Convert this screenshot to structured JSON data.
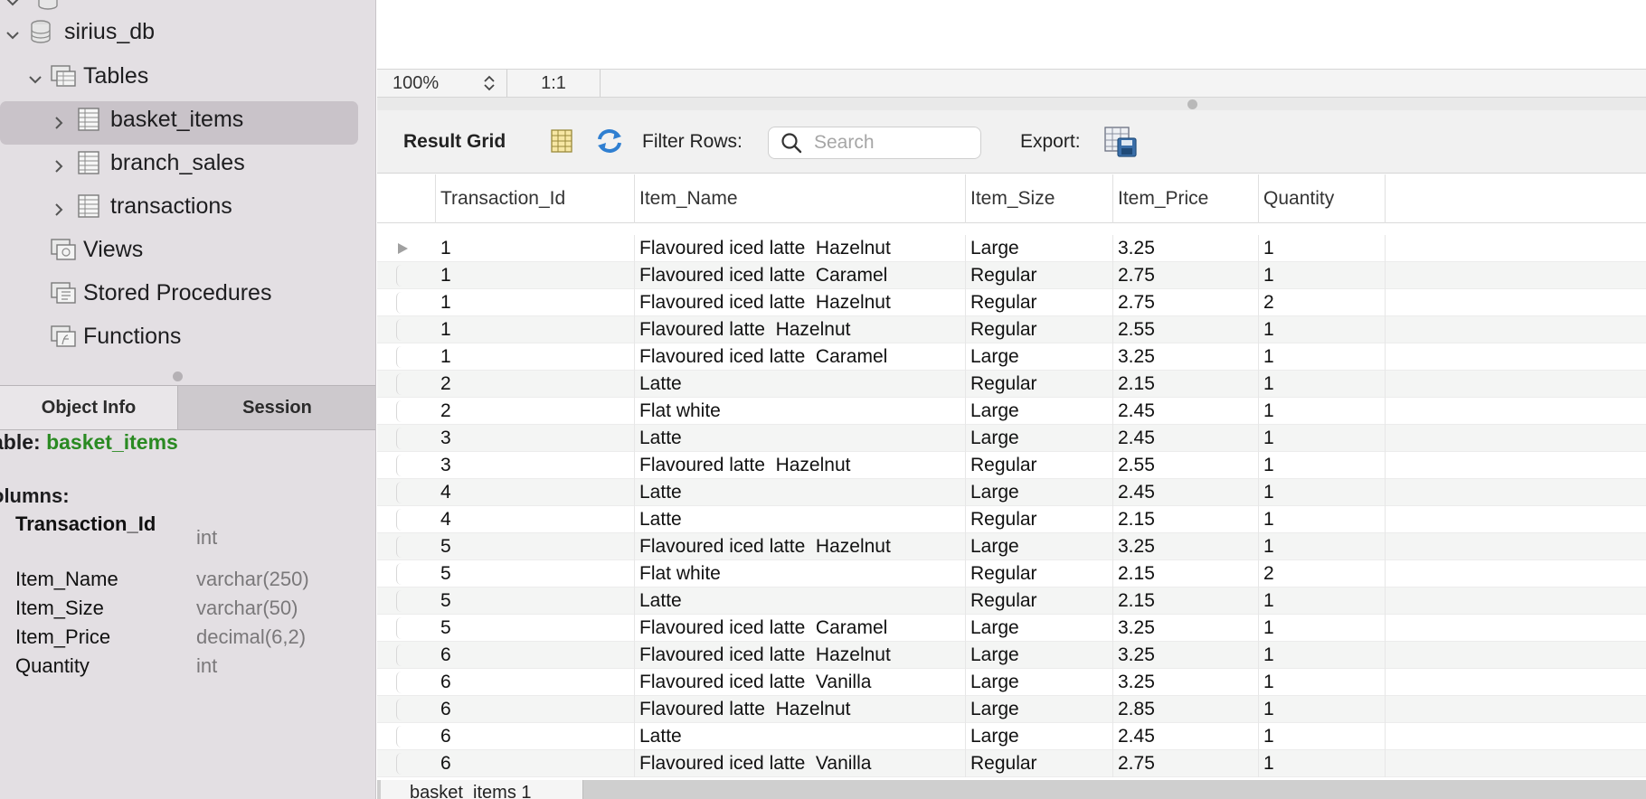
{
  "navigator": {
    "schema": "sirius_db",
    "tables_label": "Tables",
    "tables": [
      "basket_items",
      "branch_sales",
      "transactions"
    ],
    "selected_table": "basket_items",
    "views_label": "Views",
    "procedures_label": "Stored Procedures",
    "functions_label": "Functions"
  },
  "info_panel": {
    "tabs": [
      "Object Info",
      "Session"
    ],
    "active_tab": "Object Info",
    "table_prefix": "able:",
    "table_name": "basket_items",
    "columns_label": "olumns:",
    "columns": [
      {
        "name": "Transaction_Id",
        "type": "int"
      },
      {
        "name": "Item_Name",
        "type": "varchar(250)"
      },
      {
        "name": "Item_Size",
        "type": "varchar(50)"
      },
      {
        "name": "Item_Price",
        "type": "decimal(6,2)"
      },
      {
        "name": "Quantity",
        "type": "int"
      }
    ]
  },
  "editor": {
    "zoom": "100%",
    "ratio": "1:1"
  },
  "result_toolbar": {
    "title": "Result Grid",
    "filter_label": "Filter Rows:",
    "search_placeholder": "Search",
    "export_label": "Export:"
  },
  "grid": {
    "columns": [
      "Transaction_Id",
      "Item_Name",
      "Item_Size",
      "Item_Price",
      "Quantity"
    ],
    "rows": [
      [
        "1",
        "Flavoured iced latte  Hazelnut",
        "Large",
        "3.25",
        "1"
      ],
      [
        "1",
        "Flavoured iced latte  Caramel",
        "Regular",
        "2.75",
        "1"
      ],
      [
        "1",
        "Flavoured iced latte  Hazelnut",
        "Regular",
        "2.75",
        "2"
      ],
      [
        "1",
        "Flavoured latte  Hazelnut",
        "Regular",
        "2.55",
        "1"
      ],
      [
        "1",
        "Flavoured iced latte  Caramel",
        "Large",
        "3.25",
        "1"
      ],
      [
        "2",
        "Latte",
        "Regular",
        "2.15",
        "1"
      ],
      [
        "2",
        "Flat white",
        "Large",
        "2.45",
        "1"
      ],
      [
        "3",
        "Latte",
        "Large",
        "2.45",
        "1"
      ],
      [
        "3",
        "Flavoured latte  Hazelnut",
        "Regular",
        "2.55",
        "1"
      ],
      [
        "4",
        "Latte",
        "Large",
        "2.45",
        "1"
      ],
      [
        "4",
        "Latte",
        "Regular",
        "2.15",
        "1"
      ],
      [
        "5",
        "Flavoured iced latte  Hazelnut",
        "Large",
        "3.25",
        "1"
      ],
      [
        "5",
        "Flat white",
        "Regular",
        "2.15",
        "2"
      ],
      [
        "5",
        "Latte",
        "Regular",
        "2.15",
        "1"
      ],
      [
        "5",
        "Flavoured iced latte  Caramel",
        "Large",
        "3.25",
        "1"
      ],
      [
        "6",
        "Flavoured iced latte  Hazelnut",
        "Large",
        "3.25",
        "1"
      ],
      [
        "6",
        "Flavoured iced latte  Vanilla",
        "Large",
        "3.25",
        "1"
      ],
      [
        "6",
        "Flavoured latte  Hazelnut",
        "Large",
        "2.85",
        "1"
      ],
      [
        "6",
        "Latte",
        "Large",
        "2.45",
        "1"
      ],
      [
        "6",
        "Flavoured iced latte  Vanilla",
        "Regular",
        "2.75",
        "1"
      ]
    ]
  },
  "result_tab": {
    "label": "basket_items 1"
  },
  "colors": {
    "sidebar_bg": "#e3dfe3",
    "selection_bg": "#c9c3c9",
    "table_name_green": "#2a8a22",
    "type_gray": "#7a787a",
    "refresh_blue": "#2f7fd1"
  }
}
